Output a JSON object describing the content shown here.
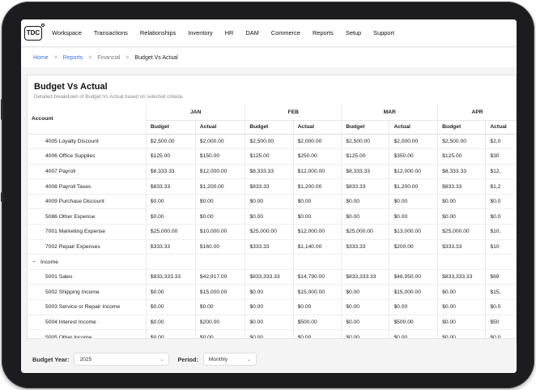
{
  "nav": {
    "logo": "TDC",
    "items": [
      "Workspace",
      "Transactions",
      "Relationships",
      "Inventory",
      "HR",
      "DAM",
      "Commerce",
      "Reports",
      "Setup",
      "Support"
    ]
  },
  "breadcrumb": {
    "home": "Home",
    "reports": "Reports",
    "financial": "Financial",
    "current": "Budget Vs Actual",
    "separator": ">"
  },
  "page": {
    "title": "Budget Vs Actual",
    "subtitle": "Detailed breakdown of Budget Vs Actual based on selected criteria."
  },
  "table": {
    "account_header": "Account",
    "months": [
      "JAN",
      "FEB",
      "MAR",
      "APR"
    ],
    "sub_headers": [
      "Budget",
      "Actual"
    ],
    "rows": [
      {
        "account": "4005 Loyalty Discount",
        "values": [
          "$2,500.00",
          "$2,000.00",
          "$2,500.00",
          "$2,000.00",
          "$2,500.00",
          "$2,000.00",
          "$2,500.00",
          "$2,0"
        ]
      },
      {
        "account": "4006 Office Supplies",
        "values": [
          "$125.00",
          "$150.00",
          "$125.00",
          "$250.00",
          "$125.00",
          "$350.00",
          "$125.00",
          "$30"
        ]
      },
      {
        "account": "4007 Payroll",
        "values": [
          "$8,333.33",
          "$12,000.00",
          "$8,333.33",
          "$12,000.00",
          "$8,333.33",
          "$12,000.00",
          "$8,333.33",
          "$12,"
        ]
      },
      {
        "account": "4008 Payroll Taxes",
        "values": [
          "$833.33",
          "$1,200.00",
          "$833.33",
          "$1,200.00",
          "$833.33",
          "$1,200.00",
          "$833.33",
          "$1,2"
        ]
      },
      {
        "account": "4009 Purchase Discount",
        "values": [
          "$0.00",
          "$0.00",
          "$0.00",
          "$0.00",
          "$0.00",
          "$0.00",
          "$0.00",
          "$0.0"
        ]
      },
      {
        "account": "5086 Other Expense",
        "values": [
          "$0.00",
          "$0.00",
          "$0.00",
          "$0.00",
          "$0.00",
          "$0.00",
          "$0.00",
          "$0.0"
        ]
      },
      {
        "account": "7001 Marketing Expense",
        "values": [
          "$25,000.00",
          "$10,000.00",
          "$25,000.00",
          "$12,000.00",
          "$25,000.00",
          "$13,000.00",
          "$25,000.00",
          "$10,"
        ]
      },
      {
        "account": "7002 Repair Expenses",
        "values": [
          "$333.33",
          "$160.00",
          "$333.33",
          "$1,140.00",
          "$333.33",
          "$200.00",
          "$333.33",
          "$10"
        ]
      },
      {
        "group": true,
        "toggle": "−",
        "account": "Income",
        "values": [
          "",
          "",
          "",
          "",
          "",
          "",
          "",
          ""
        ]
      },
      {
        "account": "5001 Sales",
        "values": [
          "$833,333.33",
          "$42,917.00",
          "$833,333.33",
          "$14,790.00",
          "$833,333.33",
          "$48,950.00",
          "$833,333.33",
          "$69"
        ]
      },
      {
        "account": "5002 Shipping Income",
        "values": [
          "$0.00",
          "$15,000.00",
          "$0.00",
          "$15,000.00",
          "$0.00",
          "$15,000.00",
          "$0.00",
          "$15,"
        ]
      },
      {
        "account": "5003 Service or Repair Income",
        "values": [
          "$0.00",
          "$0.00",
          "$0.00",
          "$0.00",
          "$0.00",
          "$0.00",
          "$0.00",
          "$0.0"
        ]
      },
      {
        "account": "5004 Interest Income",
        "values": [
          "$0.00",
          "$200.00",
          "$0.00",
          "$500.00",
          "$0.00",
          "$500.00",
          "$0.00",
          "$50"
        ]
      },
      {
        "account": "5005 Other Income",
        "values": [
          "$0.00",
          "$0.00",
          "$0.00",
          "$0.00",
          "$0.00",
          "$0.00",
          "$0.00",
          "$0.0"
        ]
      }
    ]
  },
  "filters": {
    "budget_year_label": "Budget Year:",
    "budget_year_value": "2025",
    "period_label": "Period:",
    "period_value": "Monthly"
  }
}
